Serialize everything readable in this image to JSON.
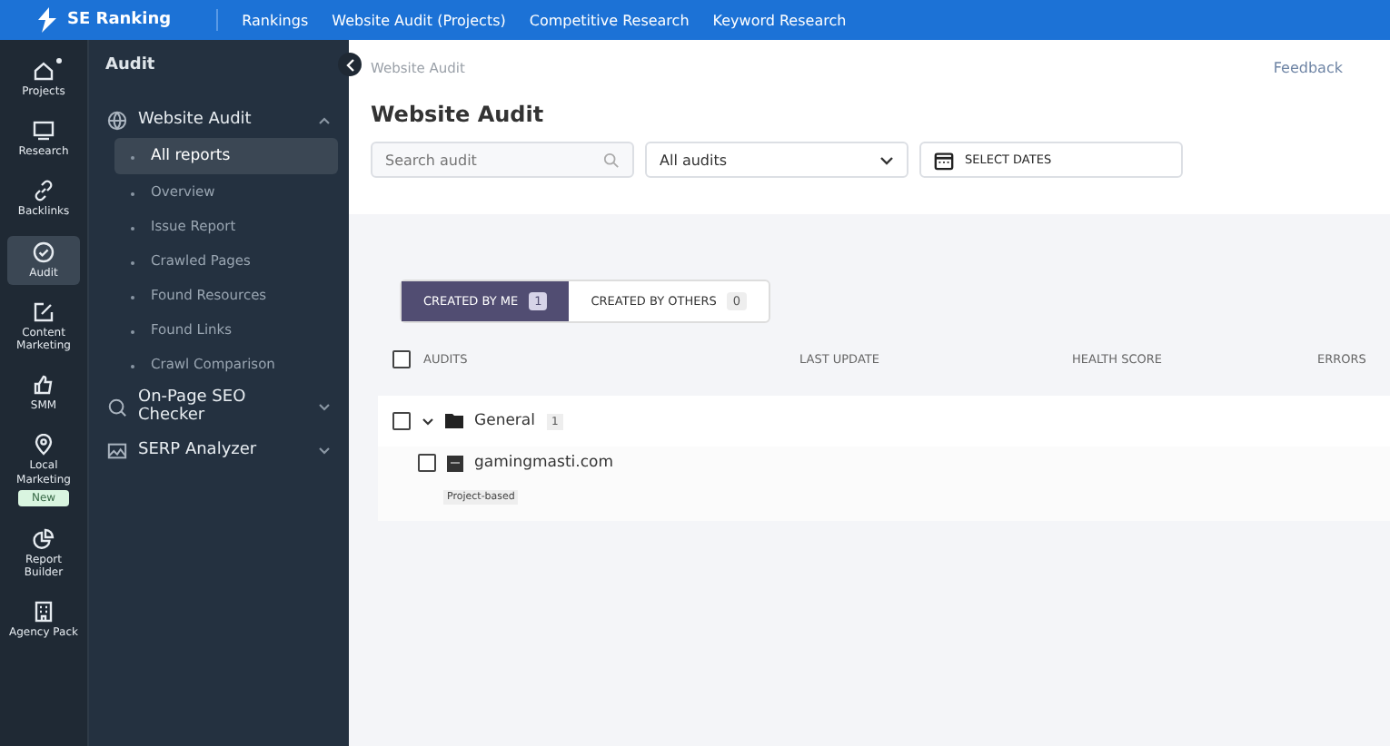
{
  "topbar": {
    "brand": "SE Ranking",
    "links": [
      "Rankings",
      "Website Audit (Projects)",
      "Competitive Research",
      "Keyword Research"
    ]
  },
  "rail": [
    {
      "label": "Projects",
      "selected": false
    },
    {
      "label": "Research",
      "selected": false
    },
    {
      "label": "Backlinks",
      "selected": false
    },
    {
      "label": "Audit",
      "selected": true
    },
    {
      "label": "Content Marketing",
      "selected": false
    },
    {
      "label": "SMM",
      "selected": false
    },
    {
      "label": "Local Marketing",
      "selected": false,
      "badge": "New"
    },
    {
      "label": "Report Builder",
      "selected": false
    },
    {
      "label": "Agency Pack",
      "selected": false
    }
  ],
  "sidebar": {
    "title": "Audit",
    "sections": [
      {
        "label": "Website Audit",
        "expanded": true,
        "items": [
          {
            "label": "All reports",
            "selected": true
          },
          {
            "label": "Overview",
            "selected": false
          },
          {
            "label": "Issue Report",
            "selected": false
          },
          {
            "label": "Crawled Pages",
            "selected": false
          },
          {
            "label": "Found Resources",
            "selected": false
          },
          {
            "label": "Found Links",
            "selected": false
          },
          {
            "label": "Crawl Comparison",
            "selected": false
          }
        ]
      },
      {
        "label": "On-Page SEO Checker",
        "expanded": false
      },
      {
        "label": "SERP Analyzer",
        "expanded": false
      }
    ]
  },
  "breadcrumb": "Website Audit",
  "feedback": "Feedback",
  "title": "Website Audit",
  "filters": {
    "search": {
      "placeholder": "Search audit"
    },
    "type": {
      "value": "All audits"
    },
    "dates": {
      "label": "SELECT DATES"
    }
  },
  "tabs": [
    {
      "label": "CREATED BY ME",
      "count": "1",
      "selected": true
    },
    {
      "label": "CREATED BY OTHERS",
      "count": "0",
      "selected": false
    }
  ],
  "table": {
    "select_all_checked": false,
    "columns": [
      "AUDITS",
      "LAST UPDATE",
      "HEALTH SCORE",
      "ERRORS"
    ],
    "groups": [
      {
        "name": "General",
        "count": "1",
        "expanded": true,
        "checked": false,
        "rows": [
          {
            "domain": "gamingmasti.com",
            "tag": "Project-based",
            "checked": false
          }
        ]
      }
    ]
  }
}
